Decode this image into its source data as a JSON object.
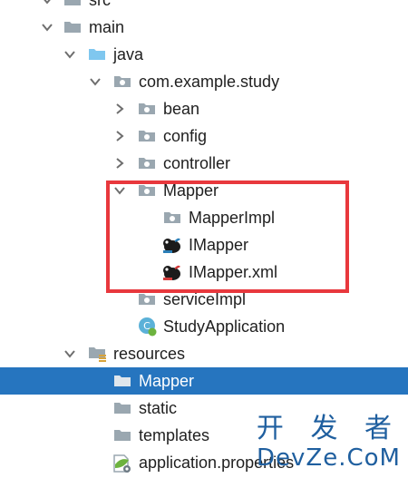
{
  "tree": {
    "items": [
      {
        "label": "src",
        "chevron": "down",
        "icon": "folder-icon"
      },
      {
        "label": "main",
        "chevron": "down",
        "icon": "folder-icon"
      },
      {
        "label": "java",
        "chevron": "down",
        "icon": "source-folder-icon"
      },
      {
        "label": "com.example.study",
        "chevron": "down",
        "icon": "package-icon"
      },
      {
        "label": "bean",
        "chevron": "right",
        "icon": "package-icon"
      },
      {
        "label": "config",
        "chevron": "right",
        "icon": "package-icon"
      },
      {
        "label": "controller",
        "chevron": "right",
        "icon": "package-icon"
      },
      {
        "label": "Mapper",
        "chevron": "down",
        "icon": "package-icon"
      },
      {
        "label": "MapperImpl",
        "chevron": "none",
        "icon": "package-icon"
      },
      {
        "label": "IMapper",
        "chevron": "none",
        "icon": "mybatis-interface-icon"
      },
      {
        "label": "IMapper.xml",
        "chevron": "none",
        "icon": "mybatis-xml-icon"
      },
      {
        "label": "serviceImpl",
        "chevron": "none",
        "icon": "package-icon"
      },
      {
        "label": "StudyApplication",
        "chevron": "none",
        "icon": "spring-boot-class-icon"
      },
      {
        "label": "resources",
        "chevron": "down",
        "icon": "resources-folder-icon"
      },
      {
        "label": "Mapper",
        "chevron": "none",
        "icon": "folder-icon",
        "selected": true
      },
      {
        "label": "static",
        "chevron": "none",
        "icon": "folder-icon"
      },
      {
        "label": "templates",
        "chevron": "none",
        "icon": "folder-icon"
      },
      {
        "label": "application.properties",
        "chevron": "none",
        "icon": "properties-file-icon"
      }
    ]
  },
  "watermark": {
    "line1": "开 发 者",
    "line2": "DevZe.CoM"
  },
  "colors": {
    "selection": "#2675bf",
    "highlight_box": "#e8383d",
    "folder": "#9aa7b0",
    "source_folder": "#7fc7ef"
  }
}
